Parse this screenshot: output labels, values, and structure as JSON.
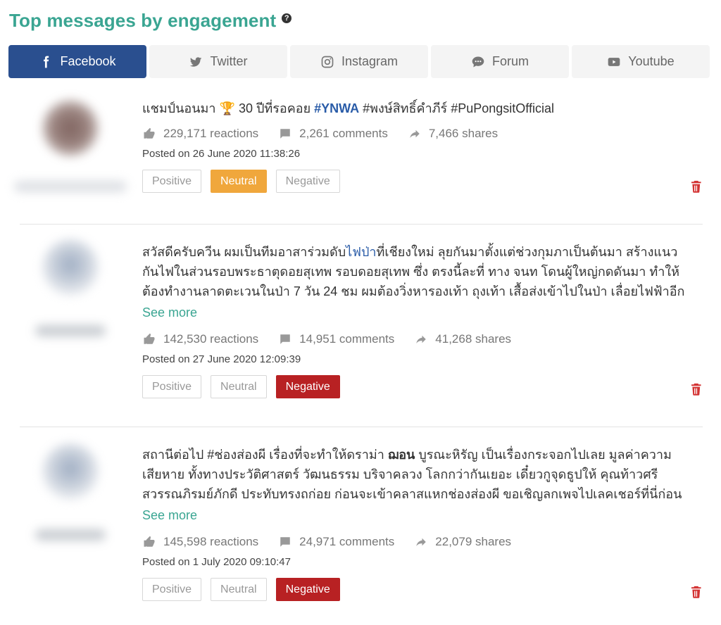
{
  "header": {
    "title": "Top messages by engagement",
    "help_glyph": "?"
  },
  "tabs": [
    {
      "label": "Facebook",
      "icon": "facebook-icon",
      "active": true
    },
    {
      "label": "Twitter",
      "icon": "twitter-icon",
      "active": false
    },
    {
      "label": "Instagram",
      "icon": "instagram-icon",
      "active": false
    },
    {
      "label": "Forum",
      "icon": "chat-bubble-icon",
      "active": false
    },
    {
      "label": "Youtube",
      "icon": "youtube-icon",
      "active": false
    }
  ],
  "sentiment_labels": {
    "positive": "Positive",
    "neutral": "Neutral",
    "negative": "Negative"
  },
  "colors": {
    "accent": "#3aa592",
    "facebook_blue": "#2a4f8f",
    "neutral": "#f0a73c",
    "negative": "#b82123",
    "trash": "#d33333"
  },
  "posts": [
    {
      "text_plain_1": "แชมป์นอนมา ",
      "trophy": "🏆",
      "text_plain_2": " 30 ปีที่รอคอย ",
      "tag": "#YNWA",
      "text_plain_3": " #พงษ์สิทธิ์คำภีร์ #PuPongsitOfficial",
      "reactions": "229,171 reactions",
      "comments": "2,261 comments",
      "shares": "7,466 shares",
      "posted": "Posted on 26 June 2020 11:38:26",
      "sentiment": "neutral"
    },
    {
      "line_1a": "สวัสดีครับควีน ผมเป็นทีมอาสาร่วมดับ",
      "line_1_tag": "ไฟป่า",
      "line_1b": "ที่เชียงใหม่ ลุยกันมาตั้งแต่ช่วงกุมภาเป็นต้นมา สร้างแนว",
      "line_2": "กันไฟในส่วนรอบพระธาตุดอยสุเทพ รอบดอยสุเทพ ซึ่ง ตรงนี้ละที่ ทาง จนท โดนผู้ใหญ่กดดันมา ทำให้",
      "line_3": "ต้องทำงานลาดตะเวนในป่า 7 วัน 24 ชม ผมต้องวิ่งหารองเท้า ถุงเท้า เสื้อส่งเข้าไปในป่า เลื่อยไฟฟ้าอีก",
      "see_more": "See more",
      "reactions": "142,530 reactions",
      "comments": "14,951 comments",
      "shares": "41,268 shares",
      "posted": "Posted on 27 June 2020 12:09:39",
      "sentiment": "negative"
    },
    {
      "line_1a": "สถานีต่อไป #ช่องส่องผี เรื่องที่จะทำให้ดราม่า ",
      "line_1_bold": "ฌอน",
      "line_1b": " บูรณะหิรัญ เป็นเรื่องกระจอกไปเลย มูลค่าความ",
      "line_2": "เสียหาย ทั้งทางประวัติศาสตร์ วัฒนธรรม บริจาคลวง โลกกว่ากันเยอะ เดี๋ยวกูจุดธูปให้ คุณท้าวศรี",
      "line_3": "สวรรณภิรมย์ภักดี ประทับทรงถก่อย ก่อนจะเข้าคลาสแหกช่องส่องผี ขอเชิญลกเพจไปเลคเชอร์ที่นี่ก่อน",
      "see_more": "See more",
      "reactions": "145,598 reactions",
      "comments": "24,971 comments",
      "shares": "22,079 shares",
      "posted": "Posted on 1 July 2020 09:10:47",
      "sentiment": "negative"
    }
  ]
}
